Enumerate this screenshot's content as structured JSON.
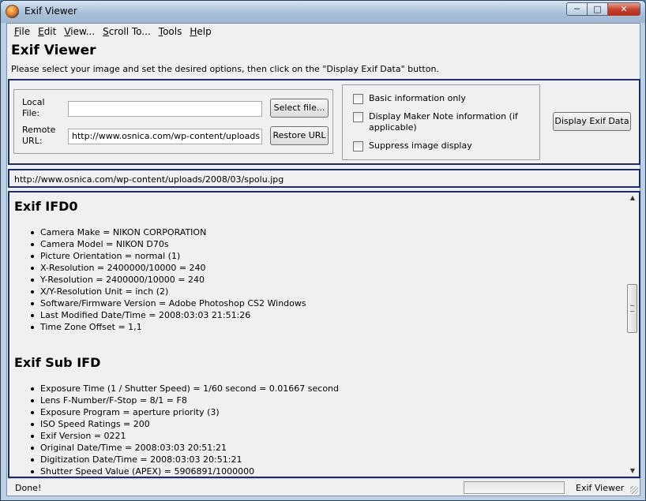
{
  "window": {
    "title": "Exif Viewer",
    "controls": {
      "minimize": "─",
      "maximize": "□",
      "close": "✕"
    }
  },
  "menubar": {
    "items": [
      {
        "mnemonic": "F",
        "rest": "ile"
      },
      {
        "mnemonic": "E",
        "rest": "dit"
      },
      {
        "mnemonic": "V",
        "rest": "iew..."
      },
      {
        "mnemonic": "S",
        "rest": "croll To..."
      },
      {
        "mnemonic": "T",
        "rest": "ools"
      },
      {
        "mnemonic": "H",
        "rest": "elp"
      }
    ]
  },
  "page": {
    "title": "Exif Viewer",
    "instruction": "Please select your image and set the desired options, then click on the \"Display Exif Data\" button."
  },
  "form": {
    "local_label": "Local File:",
    "local_value": "",
    "remote_label": "Remote URL:",
    "remote_value": "http://www.osnica.com/wp-content/uploads",
    "select_button": "Select file...",
    "restore_button": "Restore URL"
  },
  "options": {
    "basic_only": "Basic information only",
    "maker_note": "Display Maker Note information (if applicable)",
    "suppress_image": "Suppress image display"
  },
  "display_button": "Display Exif Data",
  "current_url": "http://www.osnica.com/wp-content/uploads/2008/03/spolu.jpg",
  "sections": [
    {
      "heading": "Exif IFD0",
      "items": [
        "Camera Make = NIKON CORPORATION",
        "Camera Model = NIKON D70s",
        "Picture Orientation = normal (1)",
        "X-Resolution = 2400000/10000 = 240",
        "Y-Resolution = 2400000/10000 = 240",
        "X/Y-Resolution Unit = inch (2)",
        "Software/Firmware Version = Adobe Photoshop CS2 Windows",
        "Last Modified Date/Time = 2008:03:03 21:51:26",
        "Time Zone Offset = 1,1"
      ]
    },
    {
      "heading": "Exif Sub IFD",
      "items": [
        "Exposure Time (1 / Shutter Speed) = 1/60 second = 0.01667 second",
        "Lens F-Number/F-Stop = 8/1 = F8",
        "Exposure Program = aperture priority (3)",
        "ISO Speed Ratings = 200",
        "Exif Version = 0221",
        "Original Date/Time = 2008:03:03 20:51:21",
        "Digitization Date/Time = 2008:03:03 20:51:21",
        "Shutter Speed Value (APEX) = 5906891/1000000"
      ]
    }
  ],
  "scrollbar": {
    "up": "▲",
    "down": "▼"
  },
  "status": {
    "text": "Done!",
    "app": "Exif Viewer"
  }
}
